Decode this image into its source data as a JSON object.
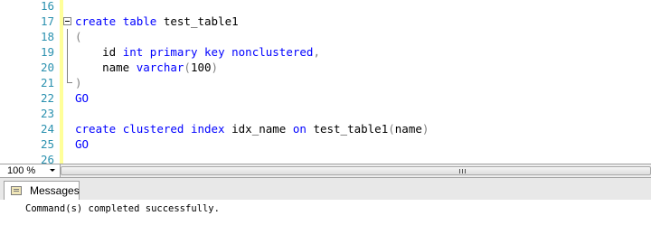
{
  "editor": {
    "lines": [
      {
        "n": "16",
        "html": ""
      },
      {
        "n": "17",
        "html": "<span class='kw'>create</span> <span class='kw'>table</span> test_table1"
      },
      {
        "n": "18",
        "html": "<span class='gray'>(</span>"
      },
      {
        "n": "19",
        "html": "    id <span class='kw'>int</span> <span class='kw'>primary</span> <span class='kw'>key</span> <span class='kw'>nonclustered</span><span class='gray'>,</span>"
      },
      {
        "n": "20",
        "html": "    name <span class='kw'>varchar</span><span class='gray'>(</span>100<span class='gray'>)</span>"
      },
      {
        "n": "21",
        "html": "<span class='gray'>)</span>"
      },
      {
        "n": "22",
        "html": "<span class='kw'>GO</span>"
      },
      {
        "n": "23",
        "html": ""
      },
      {
        "n": "24",
        "html": "<span class='kw'>create</span> <span class='kw'>clustered</span> <span class='kw'>index</span> idx_name <span class='kw'>on</span> test_table1<span class='gray'>(</span>name<span class='gray'>)</span>"
      },
      {
        "n": "25",
        "html": "<span class='kw'>GO</span>"
      },
      {
        "n": "26",
        "html": ""
      }
    ]
  },
  "zoom": {
    "value": "100 %"
  },
  "results": {
    "tab_label": "Messages",
    "message": "Command(s) completed successfully."
  }
}
